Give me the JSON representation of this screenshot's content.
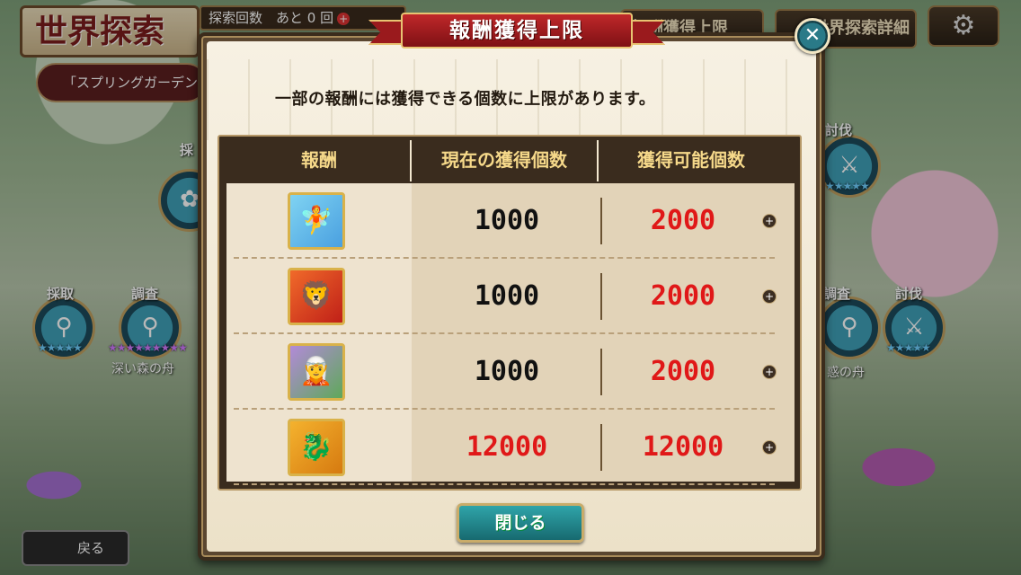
{
  "background": {
    "title": "世界探索",
    "explore_count": "探索回数　あと 0 回",
    "reward_cap_button": "報酬獲得上限",
    "explore_detail_button": "世界探索詳細",
    "area_name": "「スプリングガーデン",
    "nodes": {
      "gather_top": "採",
      "gather": "採取",
      "investigate": "調査",
      "subjugate_top": "討伐",
      "investigate_right": "調査",
      "subjugate_right": "討伐"
    },
    "ship_left": "深い森の舟",
    "ship_right": "惑の舟",
    "back_button": "戻る"
  },
  "dialog": {
    "title": "報酬獲得上限",
    "notice": "一部の報酬には獲得できる個数に上限があります。",
    "table": {
      "headers": [
        "報酬",
        "現在の獲得個数",
        "獲得可能個数"
      ],
      "rows": [
        {
          "icon": "blue-fairy-character-icon",
          "current": "1000",
          "max": "2000",
          "current_red": false
        },
        {
          "icon": "flower-lion-character-icon",
          "current": "1000",
          "max": "2000",
          "current_red": false
        },
        {
          "icon": "green-hood-character-icon",
          "current": "1000",
          "max": "2000",
          "current_red": false
        },
        {
          "icon": "pink-dragon-character-icon",
          "current": "12000",
          "max": "12000",
          "current_red": true
        }
      ]
    },
    "close_button": "閉じる"
  },
  "colors": {
    "title_ribbon": "#c0282a",
    "limit_red": "#e01818",
    "close_teal": "#2fa4a9"
  }
}
